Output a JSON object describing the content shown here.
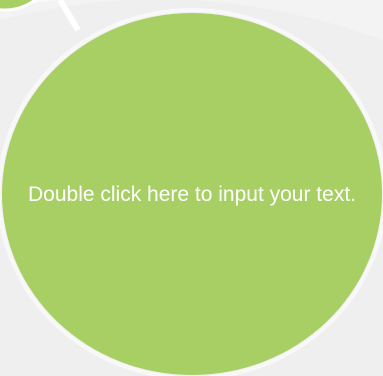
{
  "colors": {
    "page_bg": "#f5f5f5",
    "ring_light": "#fafafa",
    "ring_shadow": "#e4e4e4",
    "circle_fill": "#a7cf63",
    "text": "#ffffff"
  },
  "main_circle": {
    "text": "Double click here to input your text."
  }
}
